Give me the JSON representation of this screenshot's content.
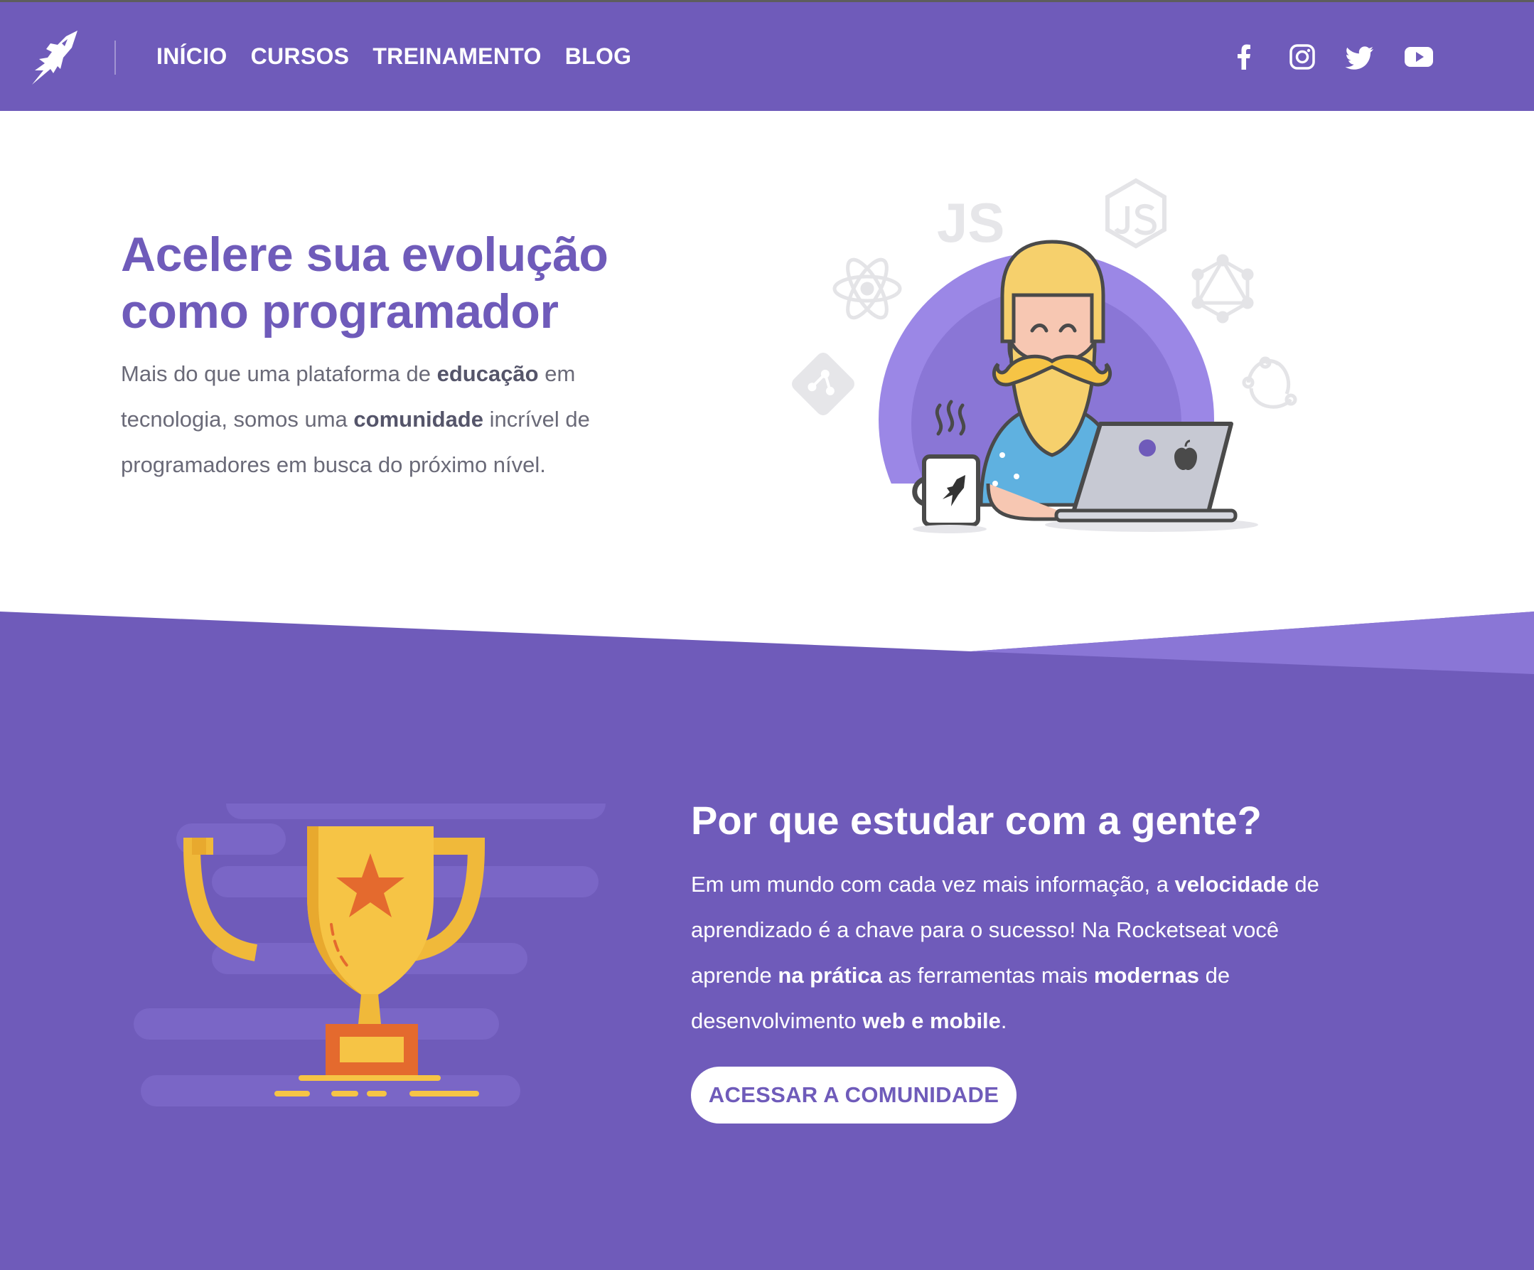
{
  "header": {
    "logo": "rocketseat-logo-icon",
    "nav": [
      {
        "label": "INÍCIO"
      },
      {
        "label": "CURSOS"
      },
      {
        "label": "TREINAMENTO"
      },
      {
        "label": "BLOG"
      }
    ],
    "social": [
      "facebook-icon",
      "instagram-icon",
      "twitter-icon",
      "youtube-icon"
    ]
  },
  "hero": {
    "title_line1": "Acelere sua evolução",
    "title_line2": "como programador",
    "text": {
      "p1": "Mais do que uma plataforma de ",
      "b1": "educação",
      "p2": " em tecnologia, somos uma ",
      "b2": "comunidade",
      "p3": " incrível de programadores em busca do próximo nível."
    },
    "illustration_labels": {
      "js": "JS"
    }
  },
  "why": {
    "title": "Por que estudar com a gente?",
    "text": {
      "p1": "Em um mundo com cada vez mais informação, a ",
      "b1": "velocidade",
      "p2": " de aprendizado é a chave para o sucesso! Na Rocketseat você aprende ",
      "b2": "na prática",
      "p3": " as ferramentas mais ",
      "b3": "modernas",
      "p4": " de desenvolvimento ",
      "b4": "web e mobile",
      "p5": "."
    },
    "cta_label": "ACESSAR A COMUNIDADE"
  },
  "colors": {
    "brand_purple": "#6f5bba",
    "light_purple": "#8a76d6",
    "trophy_yellow": "#f6c445",
    "trophy_orange": "#e46a2e"
  }
}
